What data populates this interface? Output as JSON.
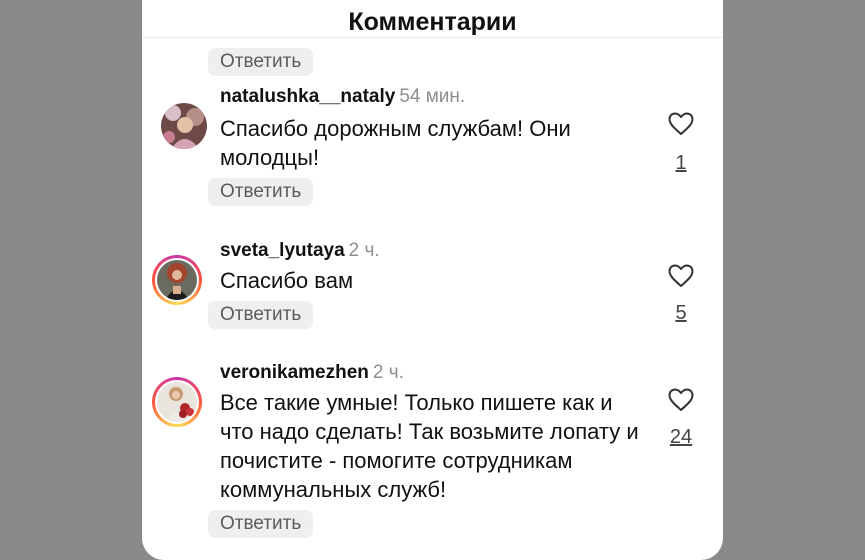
{
  "header": {
    "title": "Комментарии"
  },
  "reply_label": "Ответить",
  "comments": [
    {
      "username": "natalushka__nataly",
      "time": "54 мин.",
      "text": "Спасибо дорожным службам! Они молодцы!",
      "likes": "1",
      "story_ring": false
    },
    {
      "username": "sveta_lyutaya",
      "time": "2 ч.",
      "text": "Спасибо вам",
      "likes": "5",
      "story_ring": true
    },
    {
      "username": "veronikamezhen",
      "time": "2 ч.",
      "text": "Все такие умные! Только пишете как и что надо сделать! Так возьмите лопату и почистите - помогите сотрудникам коммунальных служб!",
      "likes": "24",
      "story_ring": true
    }
  ],
  "colors": {
    "backdrop": "#8a8a8a",
    "sheet": "#ffffff",
    "reply_bg": "#efefef",
    "meta_gray": "#8e8e8e"
  },
  "icons": [
    "heart-outline-icon",
    "avatar"
  ]
}
